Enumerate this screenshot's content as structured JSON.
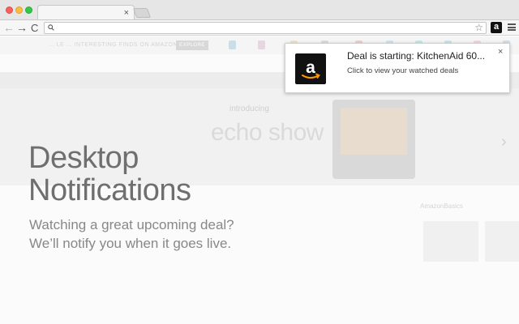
{
  "browser": {
    "tab_close": "×",
    "nav": {
      "back": "←",
      "forward": "→",
      "reload": "C"
    },
    "star_glyph": "☆",
    "extension_glyph": "a"
  },
  "page": {
    "promo": {
      "text": "... LE ... INTERESTING FINDS ON AMAZON",
      "button": "EXPLORE"
    },
    "hero": {
      "intro": "introducing",
      "title": "echo show",
      "next_arrow": "›"
    },
    "basics_label": "AmazonBasics"
  },
  "headline": {
    "line1": "Desktop",
    "line2": "Notifications"
  },
  "subcopy": {
    "line1": "Watching a great upcoming deal?",
    "line2": "We’ll notify you when it goes live."
  },
  "notification": {
    "title": "Deal is starting: KitchenAid 60...",
    "body": "Click to view your watched deals",
    "close": "×"
  },
  "colors": {
    "amazon_orange": "#ff9900",
    "logo_bg": "#111111"
  }
}
